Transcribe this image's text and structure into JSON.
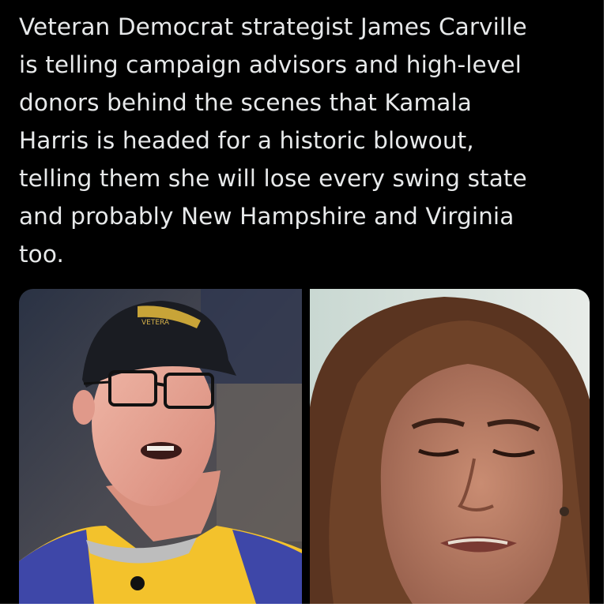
{
  "post": {
    "text_lines": [
      "Veteran Democrat strategist James Carville",
      "is telling campaign advisors and high-level",
      "donors behind the scenes that Kamala",
      "Harris is headed for a historic blowout,",
      "telling them she will lose every swing state",
      "and probably New Hampshire and Virginia",
      "too."
    ]
  },
  "media": {
    "left_photo": {
      "icon": "photo-carville",
      "cap_text": "VETERA"
    },
    "right_photo": {
      "icon": "photo-harris"
    }
  },
  "colors": {
    "background": "#000000",
    "text": "#e7e9ea",
    "frame": "#ffffff"
  }
}
